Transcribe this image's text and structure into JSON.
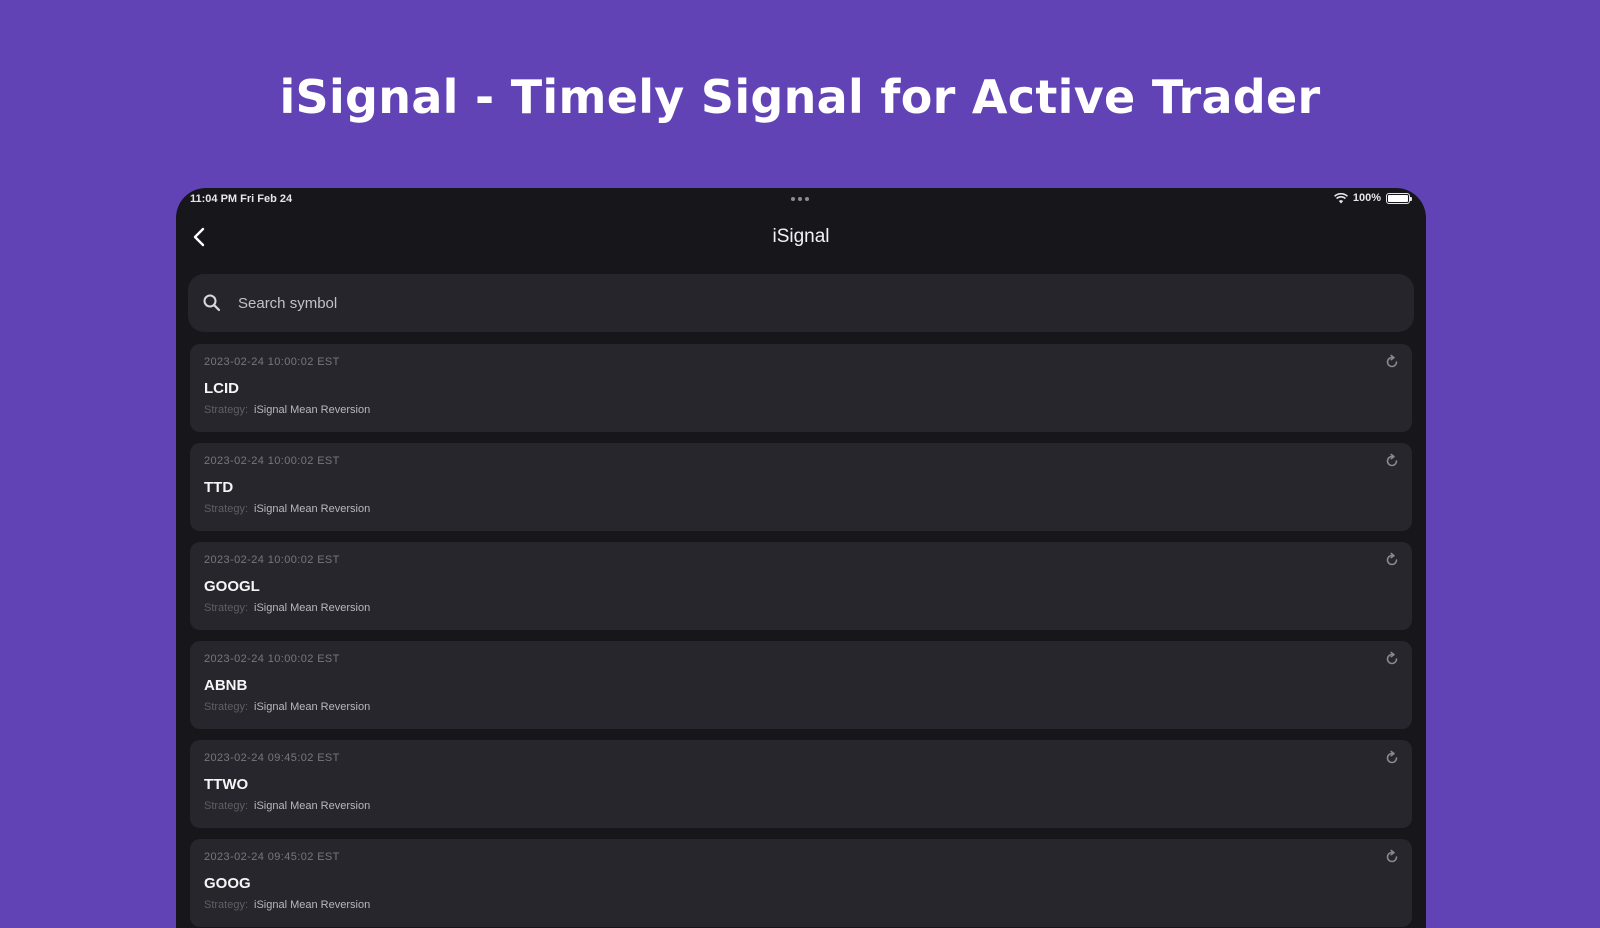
{
  "headline": "iSignal - Timely Signal for Active Trader",
  "status_bar": {
    "time": "11:04 PM  Fri Feb 24",
    "battery": "100%"
  },
  "nav": {
    "title": "iSignal"
  },
  "search": {
    "placeholder": "Search symbol",
    "value": ""
  },
  "strategy_label": "Strategy:",
  "signals": [
    {
      "time": "2023-02-24 10:00:02 EST",
      "symbol": "LCID",
      "strategy": "iSignal Mean Reversion"
    },
    {
      "time": "2023-02-24 10:00:02 EST",
      "symbol": "TTD",
      "strategy": "iSignal Mean Reversion"
    },
    {
      "time": "2023-02-24 10:00:02 EST",
      "symbol": "GOOGL",
      "strategy": "iSignal Mean Reversion"
    },
    {
      "time": "2023-02-24 10:00:02 EST",
      "symbol": "ABNB",
      "strategy": "iSignal Mean Reversion"
    },
    {
      "time": "2023-02-24 09:45:02 EST",
      "symbol": "TTWO",
      "strategy": "iSignal Mean Reversion"
    },
    {
      "time": "2023-02-24 09:45:02 EST",
      "symbol": "GOOG",
      "strategy": "iSignal Mean Reversion"
    }
  ],
  "colors": {
    "background": "#6243b6",
    "device": "#17161b",
    "card": "#27262d",
    "text_primary": "#f5f5f7",
    "text_muted": "#77767e"
  },
  "icons": {
    "back": "chevron-left-icon",
    "search": "search-icon",
    "refresh": "refresh-icon",
    "wifi": "wifi-icon",
    "battery": "battery-icon"
  }
}
